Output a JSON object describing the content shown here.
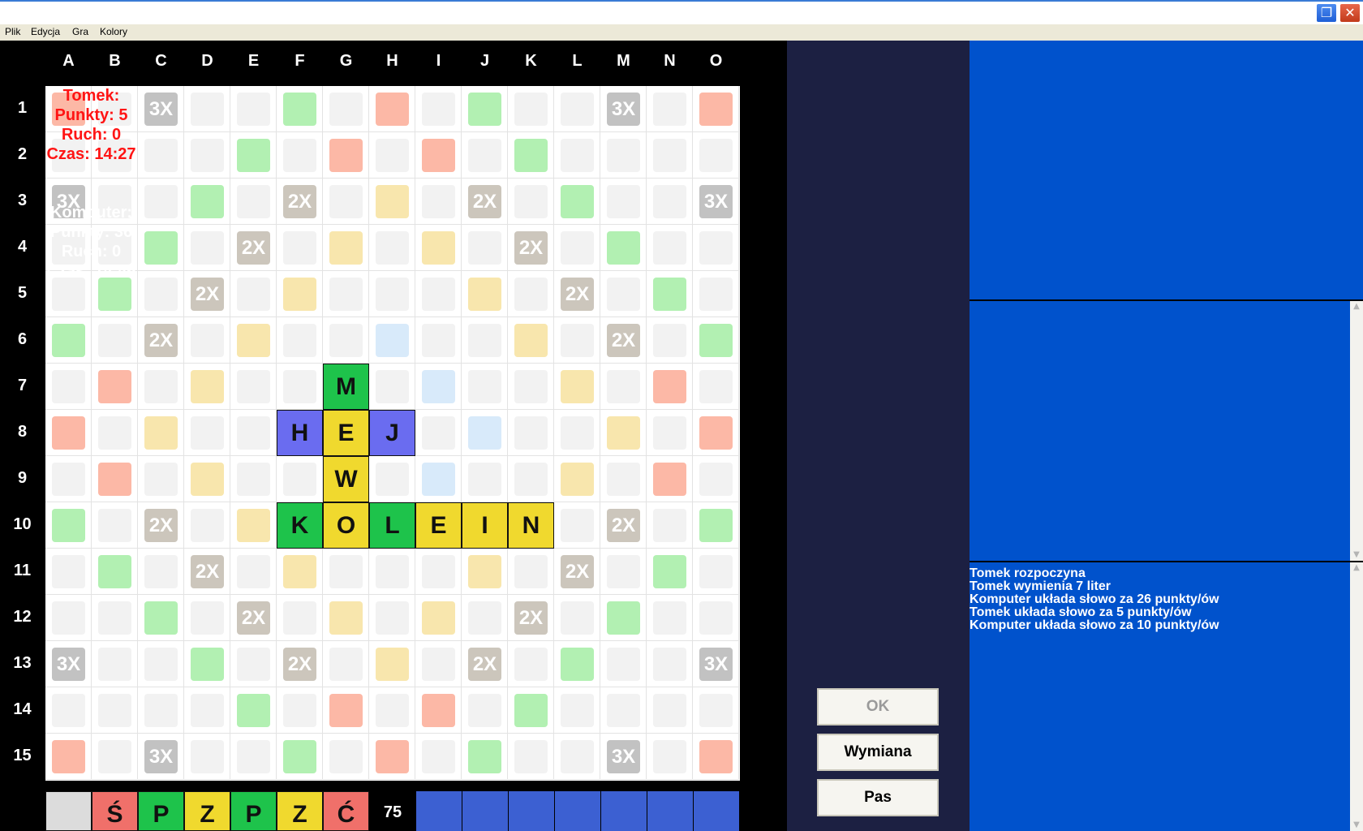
{
  "window": {
    "restore_glyph": "❐",
    "close_glyph": "✕"
  },
  "menu": [
    "Plik",
    "Edycja",
    "Gra",
    "Kolory"
  ],
  "board": {
    "columns": [
      "A",
      "B",
      "C",
      "D",
      "E",
      "F",
      "G",
      "H",
      "I",
      "J",
      "K",
      "L",
      "M",
      "N",
      "O"
    ],
    "rows": [
      "1",
      "2",
      "3",
      "4",
      "5",
      "6",
      "7",
      "8",
      "9",
      "10",
      "11",
      "12",
      "13",
      "14",
      "15"
    ],
    "layout": [
      "r.T..g.r.g..T.r",
      "....g.r.r.g....",
      "T..g.D.y.D.g..T",
      "..g.D.y.y.D.g..",
      ".g.D.y...y.D.g.",
      "g.D.y..b..y.D.g",
      ".r.y..*.b..y.r.",
      "r.y..***.b..y.r",
      ".r.y..*.b..y.r.",
      "g.D.y.......D.g",
      ".g.D.y...y.D.g.",
      "..g.D.y.y.D.g..",
      "T..g.D.y.D.g..T",
      "....g.r.r.g....",
      "r.T..g.r.g..T.r"
    ],
    "square_labels": {
      "T": "3X",
      "D": "2X"
    },
    "square_colors": {
      "r": "#fcb8a6",
      "g": "#b2f0b2",
      "y": "#f8e6ad",
      "b": "#d8eafa",
      "T": "#c2c2c2",
      "D": "#ccc6bc",
      "blank": "#f2f2f2"
    },
    "placed_tiles": [
      {
        "row": 6,
        "col": 6,
        "letter": "M",
        "color": "#1ec34b"
      },
      {
        "row": 7,
        "col": 5,
        "letter": "H",
        "color": "#6a6cf0"
      },
      {
        "row": 7,
        "col": 6,
        "letter": "E",
        "color": "#f0d92e"
      },
      {
        "row": 7,
        "col": 7,
        "letter": "J",
        "color": "#6a6cf0"
      },
      {
        "row": 8,
        "col": 6,
        "letter": "W",
        "color": "#f0d92e"
      },
      {
        "row": 9,
        "col": 5,
        "letter": "K",
        "color": "#1ec34b"
      },
      {
        "row": 9,
        "col": 6,
        "letter": "O",
        "color": "#f0d92e"
      },
      {
        "row": 9,
        "col": 7,
        "letter": "L",
        "color": "#1ec34b"
      },
      {
        "row": 9,
        "col": 8,
        "letter": "E",
        "color": "#f0d92e"
      },
      {
        "row": 9,
        "col": 9,
        "letter": "I",
        "color": "#f0d92e"
      },
      {
        "row": 9,
        "col": 10,
        "letter": "N",
        "color": "#f0d92e"
      }
    ]
  },
  "rack": {
    "tiles": [
      {
        "letter": "",
        "color": "#dcdcdc"
      },
      {
        "letter": "Ś",
        "color": "#f0706a"
      },
      {
        "letter": "P",
        "color": "#1ec34b"
      },
      {
        "letter": "Z",
        "color": "#f0d92e"
      },
      {
        "letter": "P",
        "color": "#1ec34b"
      },
      {
        "letter": "Z",
        "color": "#f0d92e"
      },
      {
        "letter": "Ć",
        "color": "#f0706a"
      }
    ],
    "bag_count": "75"
  },
  "players": [
    {
      "name": "Tomek:",
      "points": "Punkty: 5",
      "move": "Ruch: 0",
      "time": "Czas: 14:27",
      "color": "#ff1414"
    },
    {
      "name": "Komputer:",
      "points": "Punkty: 36",
      "move": "Ruch: 0",
      "time": "Czas: 14:46",
      "color": "#ffffff"
    }
  ],
  "buttons": {
    "ok": "OK",
    "exchange": "Wymiana",
    "pass": "Pas"
  },
  "log": [
    "Tomek rozpoczyna",
    "Tomek wymienia 7 liter",
    "Komputer układa słowo za 26 punkty/ów",
    "Tomek układa słowo za 5 punkty/ów",
    "Komputer układa słowo za 10 punkty/ów"
  ]
}
